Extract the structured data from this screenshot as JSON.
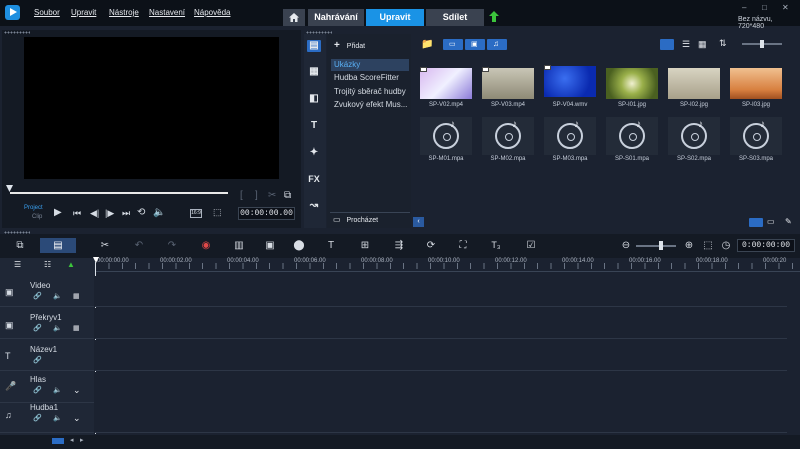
{
  "menu": {
    "items": [
      "Soubor",
      "Upravit",
      "Nástroje",
      "Nastavení",
      "Nápověda"
    ]
  },
  "tabs": {
    "capture": "Nahrávání",
    "edit": "Upravit",
    "share": "Sdílet"
  },
  "window": {
    "minimize": "–",
    "maximize": "□",
    "close": "✕",
    "project_name": "Bez názvu, 720*480"
  },
  "player": {
    "mode_project": "Project",
    "mode_clip": "Clip",
    "timecode": "00:00:00.00",
    "size_label": "16:9"
  },
  "library": {
    "add_label": "Přidat",
    "browse_label": "Procházet",
    "folders": [
      "Ukázky",
      "Hudba ScoreFitter",
      "Trojitý sběrač hudby",
      "Zvukový efekt Mus..."
    ],
    "selected_folder": 0,
    "media": [
      {
        "name": "SP-V02.mp4",
        "type": "video"
      },
      {
        "name": "SP-V03.mp4",
        "type": "video"
      },
      {
        "name": "SP-V04.wmv",
        "type": "video"
      },
      {
        "name": "SP-I01.jpg",
        "type": "image"
      },
      {
        "name": "SP-I02.jpg",
        "type": "image"
      },
      {
        "name": "SP-I03.jpg",
        "type": "image"
      },
      {
        "name": "SP-M01.mpa",
        "type": "audio"
      },
      {
        "name": "SP-M02.mpa",
        "type": "audio"
      },
      {
        "name": "SP-M03.mpa",
        "type": "audio"
      },
      {
        "name": "SP-S01.mpa",
        "type": "audio"
      },
      {
        "name": "SP-S02.mpa",
        "type": "audio"
      },
      {
        "name": "SP-S03.mpa",
        "type": "audio"
      }
    ]
  },
  "timeline": {
    "timecode": "0:00:00:00",
    "ruler_labels": [
      "00:00:00.00",
      "00:00:02.00",
      "00:00:04.00",
      "00:00:06.00",
      "00:00:08.00",
      "00:00:10.00",
      "00:00:12.00",
      "00:00:14.00",
      "00:00:16.00",
      "00:00:18.00",
      "00:00:20"
    ],
    "tracks": [
      {
        "name": "Video",
        "icon": "video-track-icon"
      },
      {
        "name": "Překryv1",
        "icon": "overlay-track-icon"
      },
      {
        "name": "Název1",
        "icon": "title-track-icon"
      },
      {
        "name": "Hlas",
        "icon": "voice-track-icon"
      },
      {
        "name": "Hudba1",
        "icon": "music-track-icon"
      }
    ]
  },
  "colors": {
    "accent": "#1a93e6",
    "background": "#1b2230",
    "topbar": "#0c1118"
  }
}
